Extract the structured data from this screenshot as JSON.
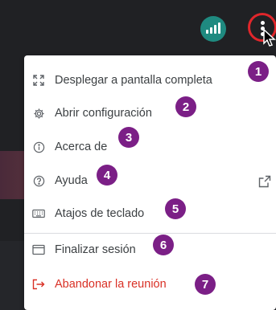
{
  "menu": {
    "items": [
      {
        "label": "Desplegar a pantalla completa",
        "icon": "fullscreen-icon"
      },
      {
        "label": "Abrir configuración",
        "icon": "gear-icon"
      },
      {
        "label": "Acerca de",
        "icon": "info-icon"
      },
      {
        "label": "Ayuda",
        "icon": "help-icon"
      },
      {
        "label": "Atajos de teclado",
        "icon": "keyboard-icon"
      },
      {
        "label": "Finalizar sesión",
        "icon": "window-icon"
      },
      {
        "label": "Abandonar la reunión",
        "icon": "leave-icon"
      }
    ]
  },
  "badges": [
    "1",
    "2",
    "3",
    "4",
    "5",
    "6",
    "7"
  ],
  "colors": {
    "accent_badge": "#7b1f86",
    "signal": "#1f8a80",
    "highlight_ring": "#e0262b",
    "danger": "#d93025"
  }
}
